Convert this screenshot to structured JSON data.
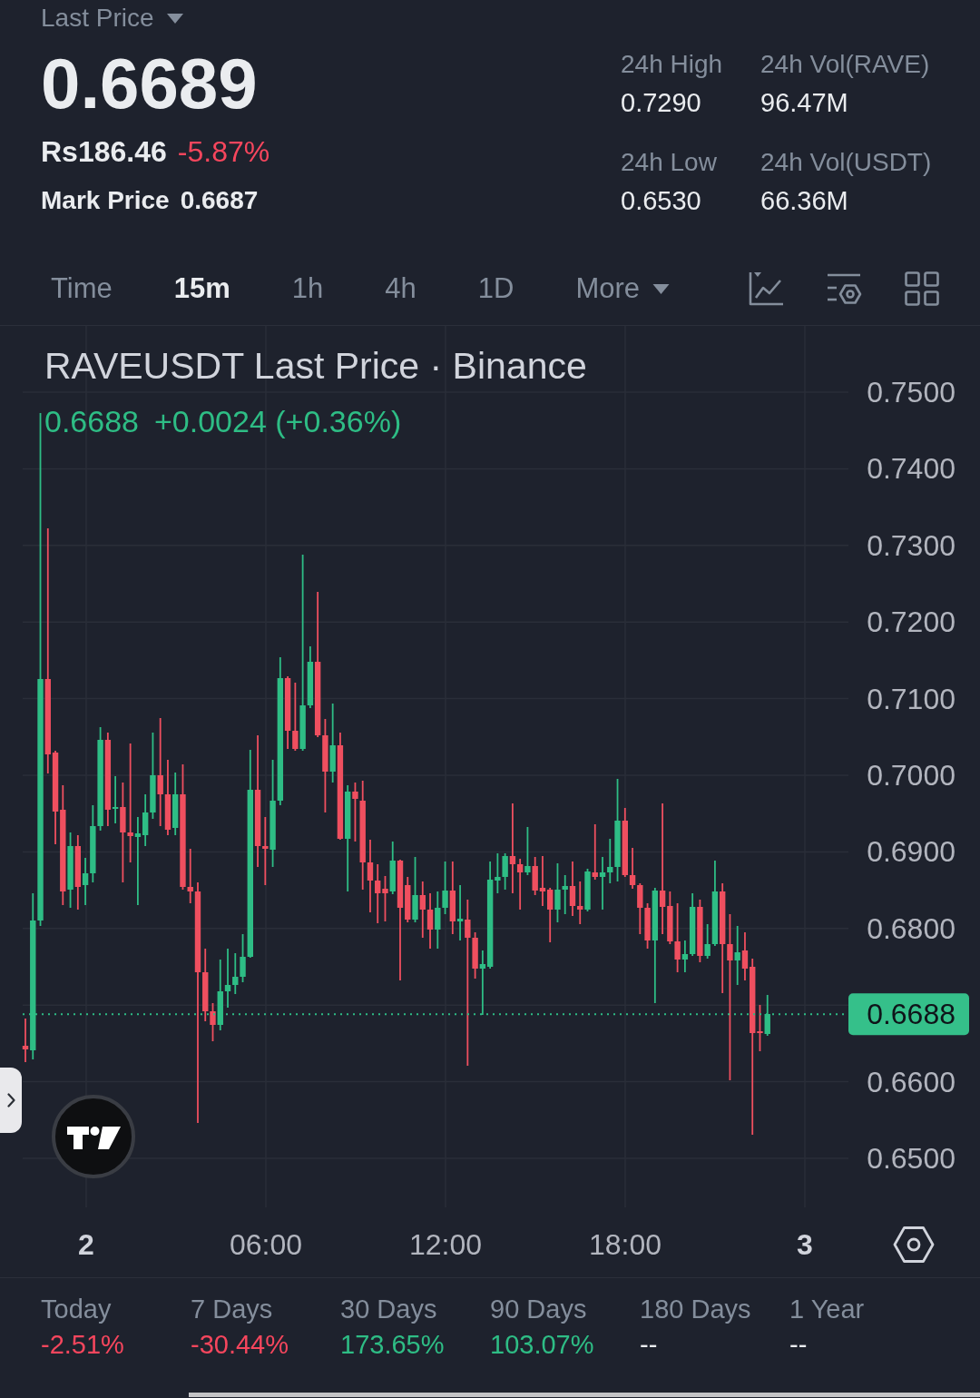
{
  "header": {
    "price_type": "Last Price",
    "last_price": "0.6689",
    "fiat_price": "Rs186.46",
    "change": {
      "text": "-5.87%",
      "color": "#f6465d"
    },
    "mark_price": {
      "label": "Mark Price",
      "value": "0.6687"
    },
    "stats": [
      {
        "label": "24h High",
        "value": "0.7290"
      },
      {
        "label": "24h Vol(RAVE)",
        "value": "96.47M"
      },
      {
        "label": "24h Low",
        "value": "0.6530"
      },
      {
        "label": "24h Vol(USDT)",
        "value": "66.36M"
      }
    ]
  },
  "intervals": [
    {
      "label": "Time",
      "kind": "interval",
      "selected": false
    },
    {
      "label": "15m",
      "kind": "interval",
      "selected": true
    },
    {
      "label": "1h",
      "kind": "interval",
      "selected": false
    },
    {
      "label": "4h",
      "kind": "interval",
      "selected": false
    },
    {
      "label": "1D",
      "kind": "interval",
      "selected": false
    },
    {
      "label": "More",
      "kind": "menu",
      "selected": false
    }
  ],
  "chart": {
    "title": "RAVEUSDT Last Price · Binance",
    "legend": {
      "close": "0.6688",
      "change": "+0.0024 (+0.36%)",
      "color": "#2ebd85"
    },
    "price_axis": [
      {
        "label": "0.7500",
        "kind": "tick"
      },
      {
        "label": "0.7400",
        "kind": "tick"
      },
      {
        "label": "0.7300",
        "kind": "tick"
      },
      {
        "label": "0.7200",
        "kind": "tick"
      },
      {
        "label": "0.7100",
        "kind": "tick"
      },
      {
        "label": "0.7000",
        "kind": "tick"
      },
      {
        "label": "0.6900",
        "kind": "tick"
      },
      {
        "label": "0.6800",
        "kind": "tick"
      },
      {
        "label": "0.6688",
        "kind": "current"
      },
      {
        "label": "0.6600",
        "kind": "tick"
      },
      {
        "label": "0.6500",
        "kind": "tick"
      }
    ],
    "time_axis": [
      {
        "label": "2",
        "kind": "day"
      },
      {
        "label": "06:00",
        "kind": "time"
      },
      {
        "label": "12:00",
        "kind": "time"
      },
      {
        "label": "18:00",
        "kind": "time"
      },
      {
        "label": "3",
        "kind": "day"
      }
    ]
  },
  "performance": [
    {
      "label": "Today",
      "change": "-2.51%",
      "color": "#f6465d"
    },
    {
      "label": "7 Days",
      "change": "-30.44%",
      "color": "#f6465d"
    },
    {
      "label": "30 Days",
      "change": "173.65%",
      "color": "#2ebd85"
    },
    {
      "label": "90 Days",
      "change": "103.07%",
      "color": "#2ebd85"
    },
    {
      "label": "180 Days",
      "change": "--",
      "color": "#eaecef"
    },
    {
      "label": "1 Year",
      "change": "--",
      "color": "#eaecef"
    }
  ]
}
